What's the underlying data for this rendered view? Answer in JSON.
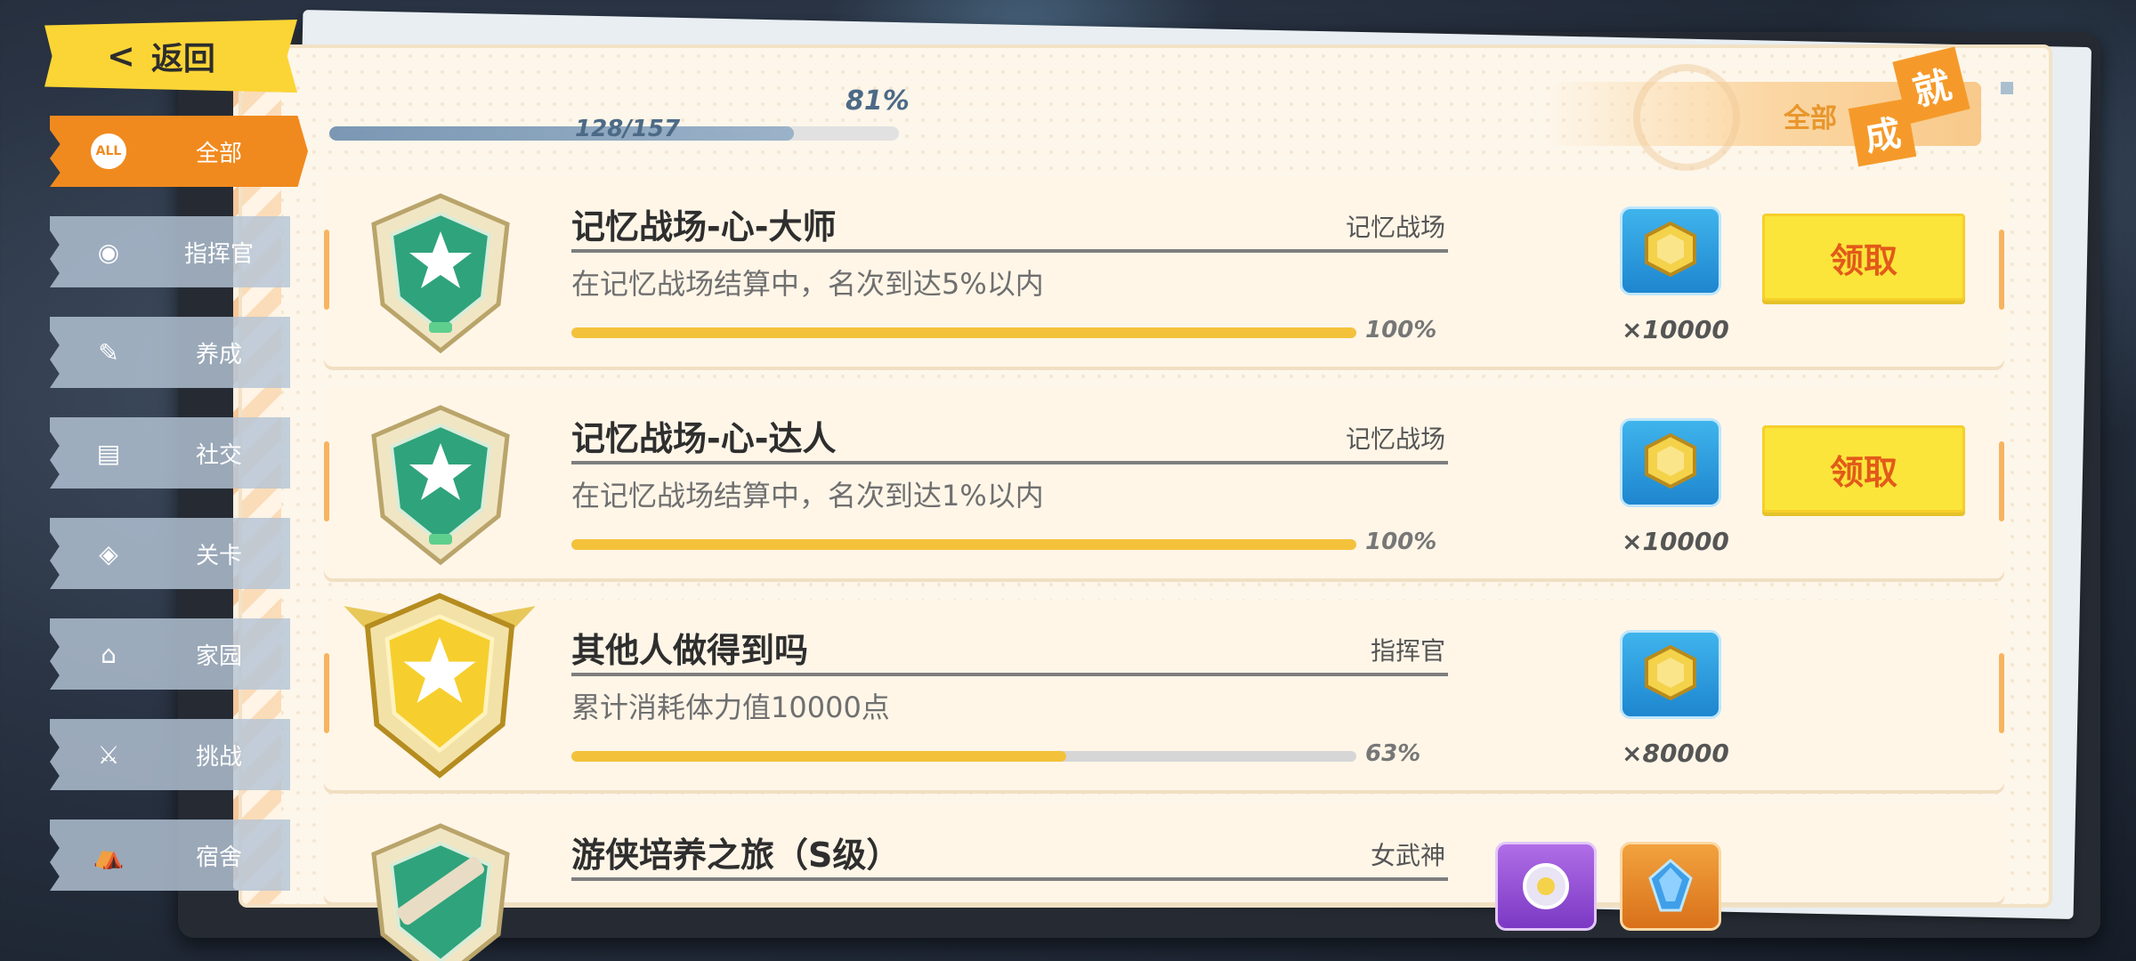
{
  "colors": {
    "accent_orange": "#f08a1e",
    "claim_yellow": "#fbe53a",
    "claim_text": "#e25a1a",
    "progress_yellow": "#f4c23a",
    "overall_blue": "#7a97b3"
  },
  "back": {
    "label": "返回",
    "icon": "chevron-left-icon"
  },
  "sidebar": {
    "items": [
      {
        "label": "全部",
        "icon": "all-badge-icon",
        "icon_text": "ALL",
        "active": true
      },
      {
        "label": "指挥官",
        "icon": "user-circle-icon",
        "active": false
      },
      {
        "label": "养成",
        "icon": "note-icon",
        "active": false
      },
      {
        "label": "社交",
        "icon": "id-card-icon",
        "active": false
      },
      {
        "label": "关卡",
        "icon": "map-pin-icon",
        "active": false
      },
      {
        "label": "家园",
        "icon": "home-icon",
        "active": false
      },
      {
        "label": "挑战",
        "icon": "swords-icon",
        "active": false
      },
      {
        "label": "宿舍",
        "icon": "dorm-icon",
        "active": false
      }
    ]
  },
  "header": {
    "percent": "81%",
    "count": "128/157",
    "completion": 0.815,
    "filter_label": "全部",
    "title_char_1": "成",
    "title_char_2": "就"
  },
  "achievements": [
    {
      "title": "记忆战场-心-大师",
      "category": "记忆战场",
      "description": "在记忆战场结算中，名次到达5%以内",
      "progress": 1.0,
      "progress_text": "100%",
      "medal": "silver-green-medal-icon",
      "rewards": [
        {
          "icon": "gold-coin-icon",
          "tile": "blue",
          "qty": "×10000"
        }
      ],
      "claim_label": "领取"
    },
    {
      "title": "记忆战场-心-达人",
      "category": "记忆战场",
      "description": "在记忆战场结算中，名次到达1%以内",
      "progress": 1.0,
      "progress_text": "100%",
      "medal": "silver-green-medal-icon",
      "rewards": [
        {
          "icon": "gold-coin-icon",
          "tile": "blue",
          "qty": "×10000"
        }
      ],
      "claim_label": "领取"
    },
    {
      "title": "其他人做得到吗",
      "category": "指挥官",
      "description": "累计消耗体力值10000点",
      "progress": 0.63,
      "progress_text": "63%",
      "medal": "gold-winged-medal-icon",
      "rewards": [
        {
          "icon": "gold-coin-icon",
          "tile": "blue",
          "qty": "×80000"
        }
      ],
      "claim_label": ""
    },
    {
      "title": "游侠培养之旅（S级）",
      "category": "女武神",
      "description": "",
      "progress": 0,
      "progress_text": "",
      "medal": "sword-medal-icon",
      "rewards": [
        {
          "icon": "gear-crystal-icon",
          "tile": "purple",
          "qty": ""
        },
        {
          "icon": "blue-crystal-icon",
          "tile": "orange",
          "qty": ""
        }
      ],
      "claim_label": ""
    }
  ]
}
